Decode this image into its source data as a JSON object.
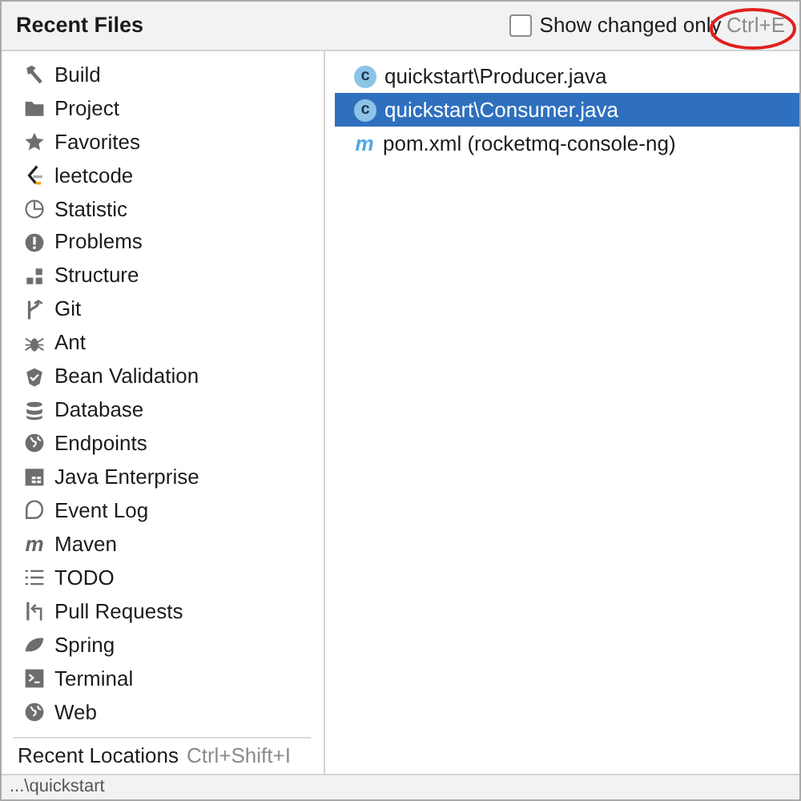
{
  "header": {
    "title": "Recent Files",
    "checkbox": {
      "label": "Show changed only",
      "checked": false
    },
    "shortcut": "Ctrl+E"
  },
  "tools": [
    {
      "label": "Build"
    },
    {
      "label": "Project"
    },
    {
      "label": "Favorites"
    },
    {
      "label": "leetcode"
    },
    {
      "label": "Statistic"
    },
    {
      "label": "Problems"
    },
    {
      "label": "Structure"
    },
    {
      "label": "Git"
    },
    {
      "label": "Ant"
    },
    {
      "label": "Bean Validation"
    },
    {
      "label": "Database"
    },
    {
      "label": "Endpoints"
    },
    {
      "label": "Java Enterprise"
    },
    {
      "label": "Event Log"
    },
    {
      "label": "Maven",
      "glyph": "m"
    },
    {
      "label": "TODO"
    },
    {
      "label": "Pull Requests"
    },
    {
      "label": "Spring"
    },
    {
      "label": "Terminal"
    },
    {
      "label": "Web"
    }
  ],
  "recent_locations": {
    "label": "Recent Locations",
    "shortcut": "Ctrl+Shift+I"
  },
  "files": [
    {
      "kind": "java",
      "glyph": "c",
      "label": "quickstart\\Producer.java",
      "selected": false
    },
    {
      "kind": "java",
      "glyph": "c",
      "label": "quickstart\\Consumer.java",
      "selected": true
    },
    {
      "kind": "maven",
      "glyph": "m",
      "label": "pom.xml (rocketmq-console-ng)",
      "selected": false
    }
  ],
  "status_bar": "...\\quickstart"
}
